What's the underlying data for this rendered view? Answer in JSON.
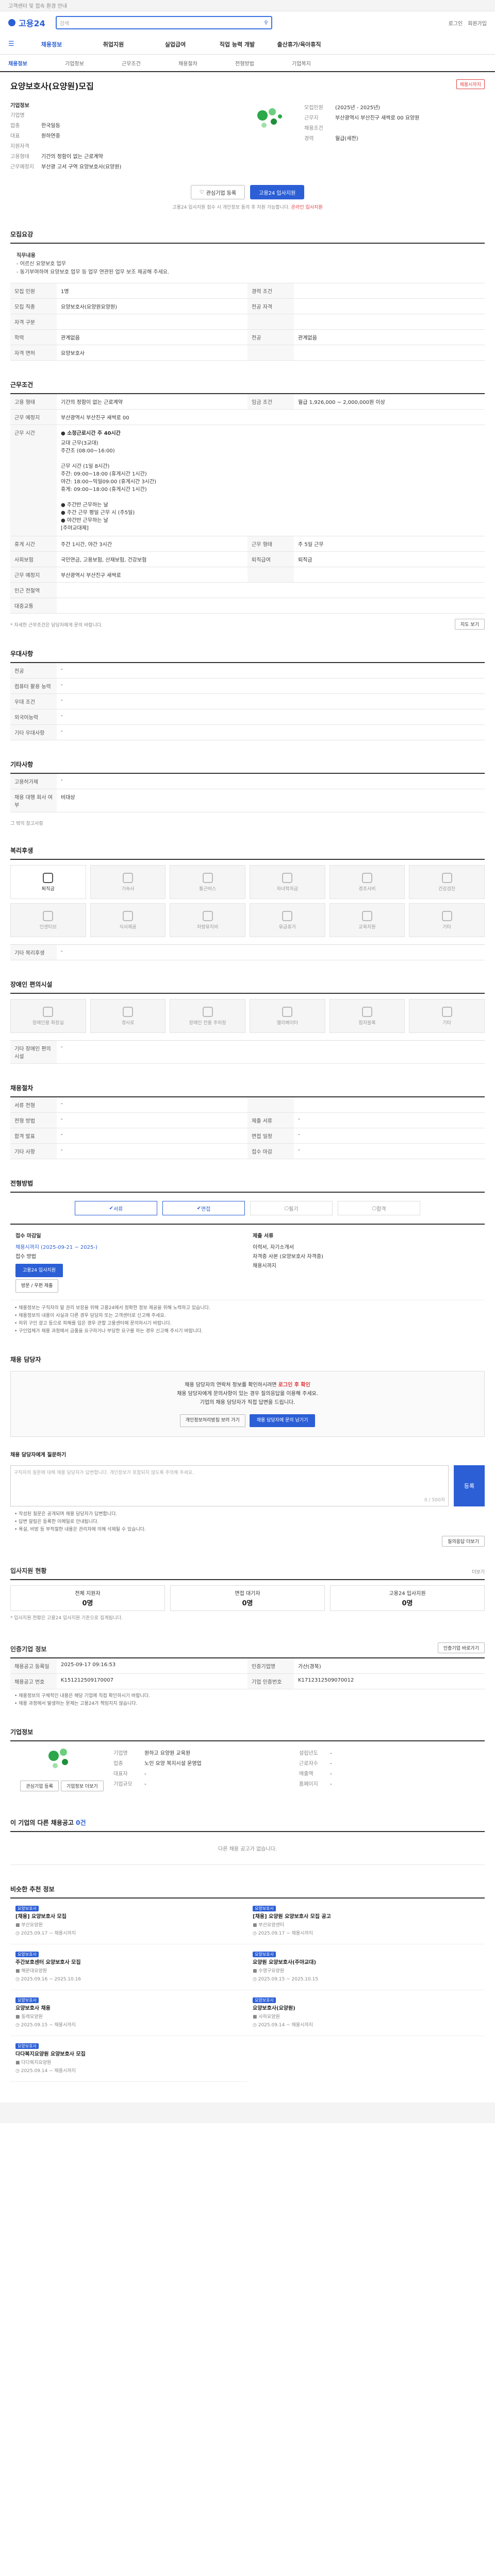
{
  "topbar": {
    "notice": "고객센터 및 접속 환경 안내"
  },
  "header": {
    "logo": "고용24",
    "search_placeholder": "검색",
    "link_login": "로그인",
    "link_join": "회원가입"
  },
  "gnb": [
    "채용정보",
    "취업지원",
    "실업급여",
    "직업 능력 개발",
    "출산휴가/육아휴직"
  ],
  "subnav": [
    "채용정보",
    "기업정보",
    "근무조건",
    "채용절차",
    "전형방법",
    "기업복지"
  ],
  "job": {
    "title": "요양보호사(요양원)모집",
    "status": "채용시까지",
    "company_label": "기업정보",
    "company_rows": [
      {
        "k": "기업명",
        "v": ""
      },
      {
        "k": "업종",
        "v": "한국일등"
      },
      {
        "k": "대표",
        "v": "원하연중"
      },
      {
        "k": "",
        "v": ""
      },
      {
        "k": "지원자격",
        "v": ""
      },
      {
        "k": "고용형태",
        "v": "기간의 정함이 없는 근로계약"
      },
      {
        "k": "근무예정지",
        "v": "부산광 고서 구역 요양보호사(요양원)"
      }
    ],
    "right_rows": [
      {
        "k": "모집인원",
        "v": "(2025년 - 2025년)"
      },
      {
        "k": "근무지",
        "v": "부산광역시 부산진구 새싹로 00 요양원"
      },
      {
        "k": "",
        "v": ""
      },
      {
        "k": "채용조건",
        "v": ""
      },
      {
        "k": "경력",
        "v": "월급(세전)"
      }
    ]
  },
  "buttons": {
    "interest": "관심기업 등록",
    "apply": "고용24 입사지원"
  },
  "notice_line": {
    "text": "고용24 입사지원 접수 시 개인정보 동의 후 지원 가능합니다.",
    "red": "온라인 입사지원"
  },
  "section_recruit": {
    "title": "모집요강",
    "intro": "직무내용",
    "intro_lines": [
      "- 어르신 요양보호 업무",
      "- 동기부여하며 요양보호 업무 등 업무 연관된 업무 보조 제공해 주세요."
    ],
    "rows": [
      {
        "k": "모집 인원",
        "v": "1명",
        "k2": "경력 조건",
        "v2": ""
      },
      {
        "k": "모집 직종",
        "v": "요양보호사(요양원요양원)",
        "k2": "전공 자격",
        "v2": ""
      },
      {
        "k": "자격 구분",
        "v": "",
        "k2": "",
        "v2": ""
      },
      {
        "k": "학력",
        "v": "관계없음",
        "k2": "전공",
        "v2": "관계없음"
      },
      {
        "k": "자격 면허",
        "v": "요양보호사",
        "k2": "",
        "v2": ""
      }
    ]
  },
  "section_conditions": {
    "title": "근무조건",
    "rows": [
      {
        "k": "고용 형태",
        "v": "기간의 정함이 없는 근로계약",
        "k2": "임금 조건",
        "v2": "월급 1,926,000 ~ 2,000,000원 이상"
      },
      {
        "k": "근무 예정지",
        "v": "부산광역시 부산진구 새싹로 00"
      }
    ],
    "hours_head": "● 소정근로시간 주 40시간",
    "hours_lines": [
      "교대 근무(3교대)",
      "주간조 (08:00~16:00)",
      "",
      "근무 시간 (1일 8시간)",
      "주간: 09:00~18:00 (휴게시간 1시간)",
      "야간: 18:00~익일09:00 (휴게시간 3시간)",
      "휴게: 09:00~18:00 (휴게시간 1시간)",
      "",
      "● 주간반 근무하는 날",
      "● 주간 근무 평일 근무 시 (주5일)",
      "● 야간반 근무하는 날",
      "[주야교대제]"
    ],
    "rows2": [
      {
        "k": "휴게 시간",
        "v": "주간 1시간, 야간 3시간",
        "k2": "근무 형태",
        "v2": "주 5일 근무"
      },
      {
        "k": "사회보험",
        "v": "국민연금, 고용보험, 산재보험, 건강보험",
        "k2": "퇴직급여",
        "v2": "퇴직금"
      },
      {
        "k": "근무 예정지",
        "v": "부산광역시 부산진구 새싹로",
        "k2": "",
        "v2": ""
      },
      {
        "k": "인근 전철역",
        "v": ""
      },
      {
        "k": "대중교통",
        "v": ""
      }
    ],
    "note": "* 자세한 근무조건은 담당자에게 문의 바랍니다.",
    "map_button": "지도 보기"
  },
  "section_apply_condition": {
    "title": "우대사항",
    "rows": [
      {
        "k": "전공",
        "v": "-"
      },
      {
        "k": "컴퓨터 활용 능력",
        "v": "-"
      },
      {
        "k": "우대 조건",
        "v": "-"
      },
      {
        "k": "외국어능력",
        "v": "-"
      },
      {
        "k": "기타 우대사항",
        "v": "-"
      }
    ]
  },
  "section_extra": {
    "title": "기타사항",
    "rows": [
      {
        "k": "고용허가제",
        "v": "-"
      },
      {
        "k": "채용 대행 회사 여부",
        "v": "비대상"
      }
    ],
    "note": "그 밖의 참고사항"
  },
  "section_welfare": {
    "title": "복리후생",
    "items": [
      {
        "label": "퇴직금",
        "on": true
      },
      {
        "label": "기숙사",
        "on": false
      },
      {
        "label": "통근버스",
        "on": false
      },
      {
        "label": "자녀학자금",
        "on": false
      },
      {
        "label": "경조사비",
        "on": false
      },
      {
        "label": "건강검진",
        "on": false
      },
      {
        "label": "인센티브",
        "on": false
      },
      {
        "label": "식사제공",
        "on": false
      },
      {
        "label": "차량유지비",
        "on": false
      },
      {
        "label": "유급휴가",
        "on": false
      },
      {
        "label": "교육지원",
        "on": false
      },
      {
        "label": "기타",
        "on": false
      }
    ],
    "extra_label": "기타 복리후생"
  },
  "section_disabled": {
    "title": "장애인 편의시설",
    "items": [
      {
        "label": "장애인용 화장실"
      },
      {
        "label": "경사로"
      },
      {
        "label": "장애인 전용 주차장"
      },
      {
        "label": "엘리베이터"
      },
      {
        "label": "점자블록"
      },
      {
        "label": "기타"
      }
    ],
    "extra_label": "기타 장애인 편의시설"
  },
  "section_process": {
    "title": "채용절차",
    "rows": [
      {
        "k": "서류 전형",
        "v": "-",
        "k2": "",
        "v2": ""
      },
      {
        "k": "전형 방법",
        "v": "-",
        "k2": "제출 서류",
        "v2": "-"
      },
      {
        "k": "합격 발표",
        "v": "-",
        "k2": "면접 일정",
        "v2": "-"
      },
      {
        "k": "기타 사항",
        "v": "-",
        "k2": "접수 마감",
        "v2": "-"
      }
    ]
  },
  "section_method": {
    "title": "전형방법",
    "steps": [
      {
        "label": "서류",
        "on": true
      },
      {
        "label": "면접",
        "on": true
      },
      {
        "label": "필기",
        "on": false
      },
      {
        "label": "합격",
        "on": false
      }
    ]
  },
  "apply_area": {
    "col1_label": "접수 마감일",
    "col1_lines": [
      "채용시까지 (2025-09-21 ~ 2025-)",
      "접수 방법"
    ],
    "apply_btn": "고용24 입사지원",
    "mail_btn": "방문 / 우편 제출",
    "col2_label": "제출 서류",
    "col2_lines": [
      "이력서, 자기소개서",
      "자격증 사본 (요양보호사 자격증)"
    ],
    "col2_extra": "채용시까지"
  },
  "apply_notes": [
    "채용정보는 구직자의 알 권리 보장을 위해 고용24에서 정확한 정보 제공을 위해 노력하고 있습니다.",
    "채용정보의 내용이 사실과 다른 경우 담당자 또는 고객센터로 신고해 주세요.",
    "허위 구인 광고 등으로 피해를 입은 경우 관할 고용센터에 문의하시기 바랍니다.",
    "구인업체가 채용 과정에서 금품을 요구하거나 부당한 요구를 하는 경우 신고해 주시기 바랍니다."
  ],
  "contact": {
    "title": "채용 담당자",
    "line1": "채용 담당자의 연락처 정보를 확인하시려면",
    "red": "로그인 후 확인",
    "line2": "채용 담당자에게 문의사항이 있는 경우 질의응답을 이용해 주세요.",
    "line3": "기업의 채용 담당자가 직접 답변을 드립니다.",
    "btn1": "개인정보처리방침 보러 가기",
    "btn2": "채용 담당자에 문의 남기기"
  },
  "qa": {
    "title": "채용 담당자에게 질문하기",
    "placeholder": "구직자의 질문에 대해 채용 담당자가 답변합니다. 개인정보가 포함되지 않도록 주의해 주세요.",
    "count": "0 / 500자",
    "btn": "등록",
    "notes": [
      "작성된 질문은 공개되며 채용 담당자가 답변합니다.",
      "답변 알림은 등록한 이메일로 안내됩니다.",
      "욕설, 비방 등 부적절한 내용은 관리자에 의해 삭제될 수 있습니다."
    ],
    "more_btn": "질의응답 더보기"
  },
  "status": {
    "title": "입사지원 현황",
    "more": "더보기",
    "cards": [
      {
        "label": "전체 지원자",
        "value": "0명"
      },
      {
        "label": "면접 대기자",
        "value": "0명"
      },
      {
        "label": "고용24 입사지원",
        "value": "0명"
      }
    ],
    "note": "* 입사지원 현황은 고용24 입사지원 기준으로 집계됩니다."
  },
  "info": {
    "title": "인증기업 정보",
    "btn": "인증기업 바로가기",
    "rows": [
      {
        "k": "채용공고 등록일",
        "v": "2025-09-17 09:16:53",
        "k2": "인증기업명",
        "v2": "가산(경북)"
      },
      {
        "k": "채용공고 번호",
        "v": "K151212509170007",
        "k2": "기업 인증번호",
        "v2": "K1712312509070012"
      }
    ],
    "notes": [
      "채용정보의 구체적인 내용은 해당 기업에 직접 확인하시기 바랍니다.",
      "채용 과정에서 발생하는 문제는 고용24가 책임지지 않습니다."
    ]
  },
  "company": {
    "title": "기업정보",
    "btn1": "관심기업 등록",
    "btn2": "기업정보 더보기",
    "rows_left": [
      {
        "k": "기업명",
        "v": "원하고 요양원 교육원"
      },
      {
        "k": "업종",
        "v": "노인 요양 복지시설 운영업"
      },
      {
        "k": "대표자",
        "v": "-"
      },
      {
        "k": "기업규모",
        "v": "-"
      }
    ],
    "rows_right": [
      {
        "k": "설립년도",
        "v": "-"
      },
      {
        "k": "근로자수",
        "v": "-"
      },
      {
        "k": "매출액",
        "v": "-"
      },
      {
        "k": "홈페이지",
        "v": "-"
      }
    ]
  },
  "more_jobs": {
    "title": "이 기업의 다른 채용공고",
    "count": "0건",
    "empty": "다른 채용 공고가 없습니다."
  },
  "similar": {
    "title": "비슷한 추천 정보",
    "items": [
      {
        "tag": "요양보호사",
        "title": "[채용] 요양보호사 모집",
        "company": "부산요양원",
        "date": "2025.09.17 ~ 채용시까지"
      },
      {
        "tag": "요양보호사",
        "title": "[채용] 요양원 요양보호사 모집 공고",
        "company": "부산요양센터",
        "date": "2025.09.17 ~ 채용시까지"
      },
      {
        "tag": "요양보호사",
        "title": "주간보호센터 요양보호사 모집",
        "company": "해운대요양원",
        "date": "2025.09.16 ~ 2025.10.16"
      },
      {
        "tag": "요양보호사",
        "title": "요양원 요양보호사(주야교대)",
        "company": "수영구요양원",
        "date": "2025.09.15 ~ 2025.10.15"
      },
      {
        "tag": "요양보호사",
        "title": "요양보호사 채용",
        "company": "동래요양원",
        "date": "2025.09.15 ~ 채용시까지"
      },
      {
        "tag": "요양보호사",
        "title": "요양보호사(요양원)",
        "company": "사하요양원",
        "date": "2025.09.14 ~ 채용시까지"
      },
      {
        "tag": "요양보호사",
        "title": "다다복지요양원 요양보호사 모집",
        "company": "다다복지요양원",
        "date": "2025.09.14 ~ 채용시까지"
      }
    ]
  }
}
